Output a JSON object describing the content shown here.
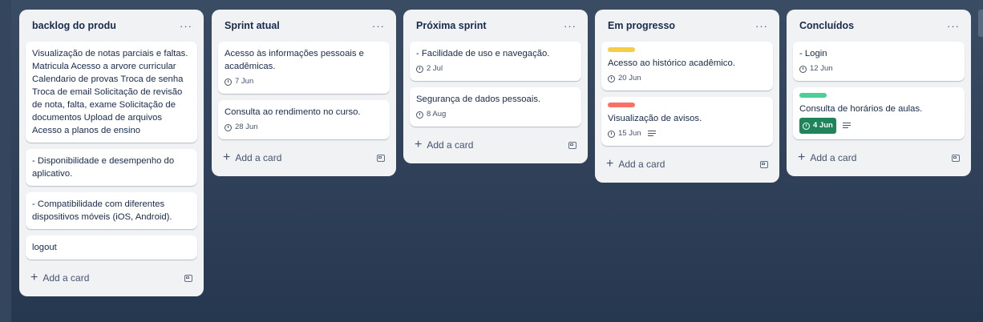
{
  "colors": {
    "label_yellow": "#f5cd47",
    "label_red": "#f87168",
    "label_green": "#4bce97",
    "done_badge": "#1f845a"
  },
  "lists": [
    {
      "title": "backlog do produ",
      "menu": "···",
      "add_label": "Add a card",
      "cards": [
        {
          "text": "Visualização de notas parciais e faltas. Matricula Acesso a arvore curricular Calendario de provas Troca de senha Troca de email Solicitação de revisão de nota, falta, exame Solicitação de documentos Upload de arquivos Acesso a planos de ensino"
        },
        {
          "text": "- Disponibilidade e desempenho do aplicativo."
        },
        {
          "text": "- Compatibilidade com diferentes dispositivos móveis (iOS, Android)."
        },
        {
          "text": "logout"
        }
      ]
    },
    {
      "title": "Sprint atual",
      "menu": "···",
      "add_label": "Add a card",
      "cards": [
        {
          "text": "Acesso às informações pessoais e acadêmicas.",
          "due": "7 Jun"
        },
        {
          "text": "Consulta ao rendimento no curso.",
          "due": "28 Jun"
        }
      ]
    },
    {
      "title": "Próxima sprint",
      "menu": "···",
      "add_label": "Add a card",
      "cards": [
        {
          "text": "- Facilidade de uso e navegação.",
          "due": "2 Jul"
        },
        {
          "text": "Segurança de dados pessoais.",
          "due": "8 Aug"
        }
      ]
    },
    {
      "title": "Em progresso",
      "menu": "···",
      "add_label": "Add a card",
      "cards": [
        {
          "text": "Acesso ao histórico acadêmico.",
          "due": "20 Jun",
          "label_color": "#f5cd47"
        },
        {
          "text": "Visualização de avisos.",
          "due": "15 Jun",
          "label_color": "#f87168",
          "has_description": true
        }
      ]
    },
    {
      "title": "Concluídos",
      "menu": "···",
      "add_label": "Add a card",
      "cards": [
        {
          "text": "- Login",
          "due": "12 Jun"
        },
        {
          "text": "Consulta de horários de aulas.",
          "due": "4 Jun",
          "due_done": true,
          "label_color": "#4bce97",
          "has_description": true
        }
      ]
    }
  ]
}
